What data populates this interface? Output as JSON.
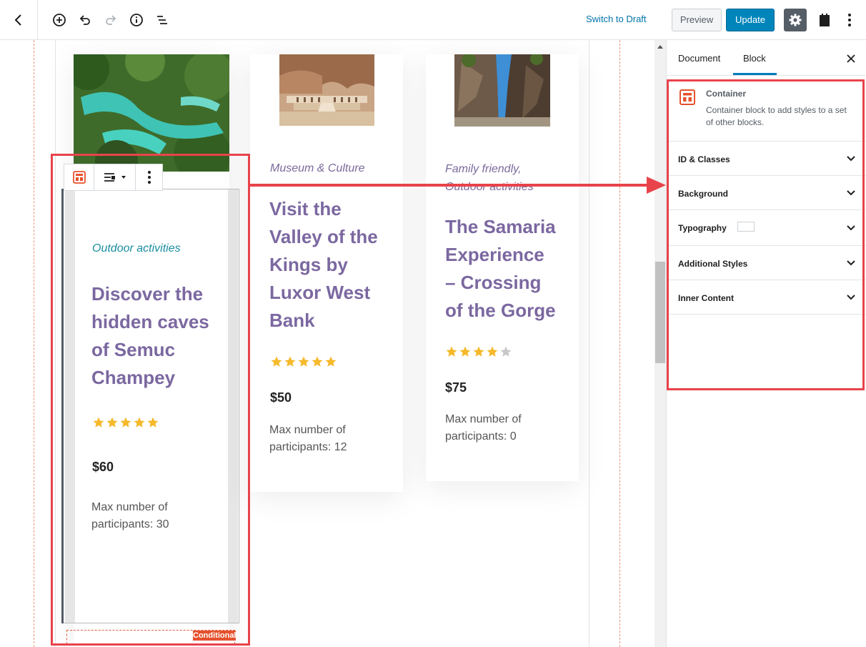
{
  "toolbar": {
    "switch_to_draft": "Switch to Draft",
    "preview": "Preview",
    "update": "Update",
    "icons": [
      "back-arrow-icon",
      "add-block-icon",
      "undo-icon",
      "redo-icon",
      "info-icon",
      "list-view-icon",
      "gear-icon",
      "plugin-icon",
      "more-vertical-icon"
    ]
  },
  "cards": [
    {
      "category": "Outdoor activities",
      "title_lines": [
        "Discover the",
        "hidden caves",
        "of Semuc",
        "Champey"
      ],
      "stars": 5,
      "price": "$60",
      "max_lines": [
        "Max number of",
        "participants: 30"
      ]
    },
    {
      "category": "Museum & Culture",
      "title_lines": [
        "Visit the",
        "Valley of the",
        "Kings by",
        "Luxor West",
        "Bank"
      ],
      "stars": 5,
      "price": "$50",
      "max_lines": [
        "Max number of",
        "participants: 12"
      ]
    },
    {
      "category_lines": [
        "Family friendly,",
        "Outdoor activities"
      ],
      "title_lines": [
        "The Samaria",
        "Experience",
        "– Crossing",
        "of the Gorge"
      ],
      "stars": 4,
      "price": "$75",
      "max_lines": [
        "Max number of",
        "participants: 0"
      ]
    }
  ],
  "conditional_tag": "Conditional",
  "colors": {
    "accent": "#0085ba",
    "title": "#7b68a0",
    "highlight": "#e8434b",
    "star": "#f5b92b"
  },
  "sidebar": {
    "tab_document": "Document",
    "tab_block": "Block",
    "block_name": "Container",
    "block_description": "Container block to add styles to a set of other blocks.",
    "panels": {
      "id_classes": "ID & Classes",
      "background": "Background",
      "typography": "Typography",
      "additional_styles": "Additional Styles",
      "inner_content": "Inner Content"
    }
  }
}
